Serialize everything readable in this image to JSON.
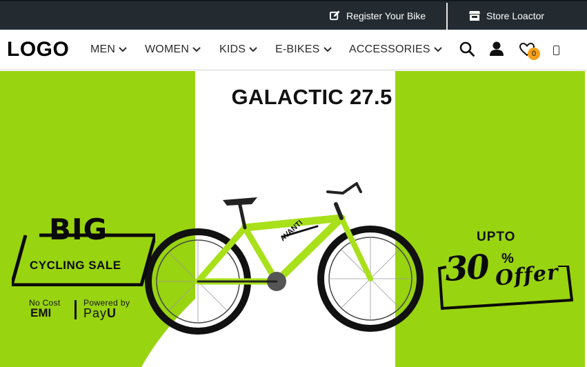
{
  "topbar": {
    "register_label": "Register Your Bike",
    "store_label": "Store Loactor"
  },
  "header": {
    "logo": "LOGO",
    "nav": [
      "MEN",
      "WOMEN",
      "KIDS",
      "E-BIKES",
      "ACCESSORIES"
    ],
    "wishlist_count": "0"
  },
  "hero": {
    "product_title": "GALACTIC 27.5",
    "sale_big": "BIG",
    "sale_sub": "CYCLING SALE",
    "emi_small": "No Cost",
    "emi_big": "EMI",
    "pay_small": "Powered by",
    "pay_big_1": "Pay",
    "pay_big_2": "U",
    "upto": "UPTO",
    "offer_number": "30",
    "offer_percent": "%",
    "offer_word": "Offer",
    "bike_color": "#a8e01a",
    "accent_color": "#99d410"
  },
  "icons": {
    "register": "edit-icon",
    "store": "store-icon",
    "search": "search-icon",
    "account": "user-icon",
    "wishlist": "heart-icon",
    "phone": "phone-icon",
    "dropdown": "chevron-down-icon"
  },
  "colors": {
    "topbar": "#232b30",
    "hero_green": "#99d410",
    "badge": "#f6a11a"
  }
}
